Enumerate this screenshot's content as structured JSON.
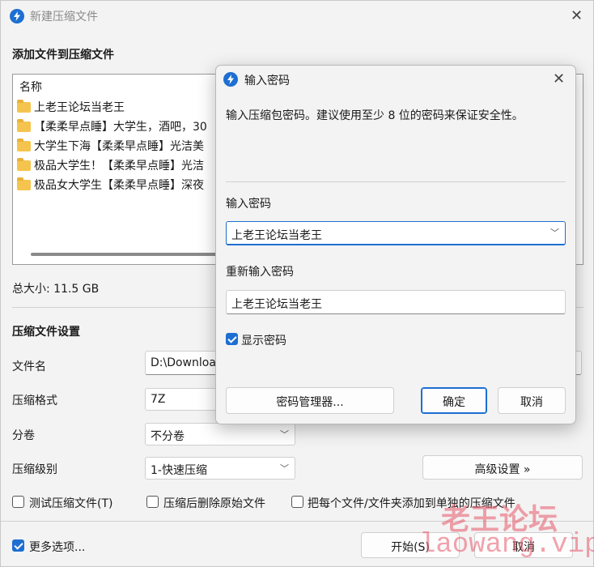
{
  "main": {
    "title": "新建压缩文件",
    "section_add": "添加文件到压缩文件",
    "list_header": "名称",
    "files": [
      "上老王论坛当老王",
      "【柔柔早点睡】大学生，酒吧，30",
      "大学生下海【柔柔早点睡】光洁美",
      "极品大学生！【柔柔早点睡】光洁",
      "极品女大学生【柔柔早点睡】深夜"
    ],
    "total_size": "总大小: 11.5 GB",
    "section_settings": "压缩文件设置",
    "filename_label": "文件名",
    "filename_value": "D:\\Downloa",
    "format_label": "压缩格式",
    "format_value": "7Z",
    "split_label": "分卷",
    "split_value": "不分卷",
    "level_label": "压缩级别",
    "level_value": "1-快速压缩",
    "advanced_button": "高级设置 »",
    "test_label": "测试压缩文件(T)",
    "delete_label": "压缩后删除原始文件",
    "each_label": "把每个文件/文件夹添加到单独的压缩文件",
    "more_options_label": "更多选项...",
    "start_button": "开始(S)",
    "cancel_button": "取消"
  },
  "dialog": {
    "title": "输入密码",
    "description": "输入压缩包密码。建议使用至少 8 位的密码来保证安全性。",
    "password_label": "输入密码",
    "password_value": "上老王论坛当老王",
    "reenter_label": "重新输入密码",
    "reenter_value": "上老王论坛当老王",
    "show_password_label": "显示密码",
    "manager_button": "密码管理器...",
    "ok_button": "确定",
    "cancel_button": "取消"
  },
  "watermark": {
    "line1": "老王论坛",
    "line2": "laowang.vip"
  },
  "colors": {
    "accent": "#1d6fd1",
    "watermark": "#e8586a"
  }
}
